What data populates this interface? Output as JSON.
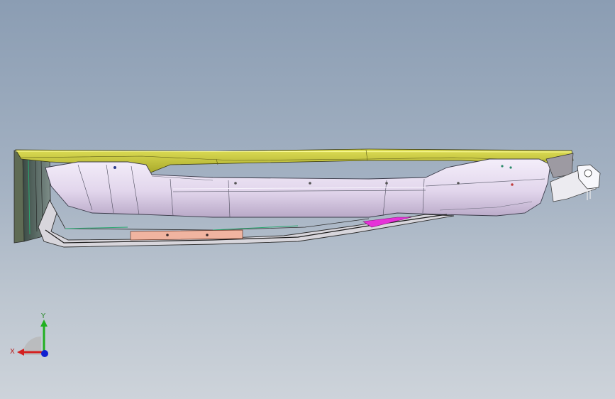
{
  "viewport": {
    "background_top": "#8b9db3",
    "background_bottom": "#cdd3da"
  },
  "model": {
    "part_colors": {
      "top_panel": "#c8c83c",
      "body": "#e6dcee",
      "rail": "#5a5a5a",
      "strip": "#f0b4a0",
      "accent": "#e632d8"
    }
  },
  "triad": {
    "x_label": "X",
    "y_label": "Y",
    "x_color": "#d42020",
    "y_color": "#20b020",
    "z_color": "#1020d0"
  }
}
